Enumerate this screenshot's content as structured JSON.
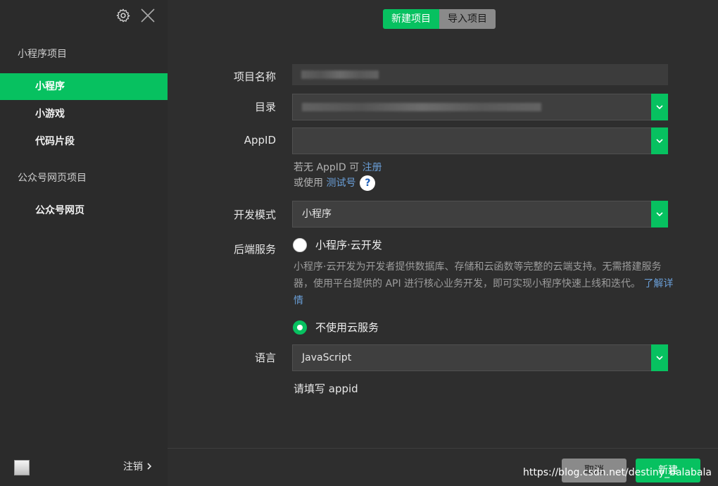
{
  "sidebar": {
    "groups": [
      {
        "title": "小程序项目"
      },
      {
        "title": "公众号网页项目"
      }
    ],
    "items": [
      {
        "label": "小程序",
        "active": true
      },
      {
        "label": "小游戏"
      },
      {
        "label": "代码片段"
      },
      {
        "label": "公众号网页"
      }
    ],
    "logout_label": "注销"
  },
  "tabs": [
    {
      "label": "新建项目",
      "active": true
    },
    {
      "label": "导入项目"
    }
  ],
  "form": {
    "name_label": "项目名称",
    "dir_label": "目录",
    "appid_label": "AppID",
    "appid_hint_prefix": "若无 AppID 可 ",
    "appid_hint_link": "注册",
    "appid_hint2_prefix": "或使用 ",
    "appid_hint2_link": "测试号",
    "help_symbol": "?",
    "mode_label": "开发模式",
    "mode_value": "小程序",
    "backend_label": "后端服务",
    "cloud_option": "小程序·云开发",
    "cloud_desc": "小程序·云开发为开发者提供数据库、存储和云函数等完整的云端支持。无需搭建服务器，使用平台提供的 API 进行核心业务开发，即可实现小程序快速上线和迭代。",
    "cloud_desc_link": "了解详情",
    "no_cloud_option": "不使用云服务",
    "lang_label": "语言",
    "lang_value": "JavaScript",
    "appid_error": "请填写 appid"
  },
  "footer": {
    "cancel_label": "取消",
    "create_label": "新建",
    "watermark": "https://blog.csdn.net/destiny_balabala"
  },
  "colors": {
    "accent": "#07c160",
    "link": "#6a9fd8"
  }
}
